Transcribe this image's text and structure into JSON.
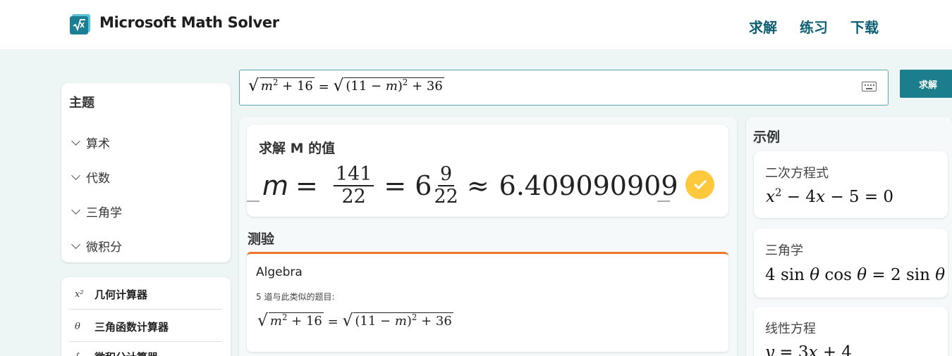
{
  "header": {
    "brand": "Microsoft Math Solver",
    "nav": [
      "求解",
      "练习",
      "下载"
    ]
  },
  "sidebar": {
    "topics_title": "主题",
    "topics": [
      "算术",
      "代数",
      "三角学",
      "微积分"
    ],
    "calculators": [
      {
        "icon": "x²",
        "label": "几何计算器"
      },
      {
        "icon": "θ",
        "label": "三角函数计算器"
      },
      {
        "icon": "∫",
        "label": "微积分计算器"
      }
    ]
  },
  "search": {
    "lhs_base": "m",
    "lhs_exp": "2",
    "lhs_rest": "+ 16",
    "equals": "=",
    "rhs_open": "(11 −",
    "rhs_var": "m",
    "rhs_close": ")",
    "rhs_exp": "2",
    "rhs_rest": "+ 36",
    "button": "求解"
  },
  "solution": {
    "title": "求解 M 的值",
    "var": "m",
    "eq1": "=",
    "frac_num": "141",
    "frac_den": "22",
    "eq2": "=",
    "whole": "6",
    "mixed_num": "9",
    "mixed_den": "22",
    "approx": "≈",
    "decimal": "6.409090909"
  },
  "quiz": {
    "section_title": "测验",
    "subject": "Algebra",
    "count_text": "5 道与此类似的题目:"
  },
  "examples": {
    "title": "示例",
    "items": [
      {
        "name": "二次方程式"
      },
      {
        "name": "三角学"
      },
      {
        "name": "线性方程"
      }
    ]
  },
  "colors": {
    "accent": "#1c7d8c",
    "nav_text": "#0e5f73",
    "quiz_border": "#f0762d",
    "check": "#ffc83d"
  }
}
